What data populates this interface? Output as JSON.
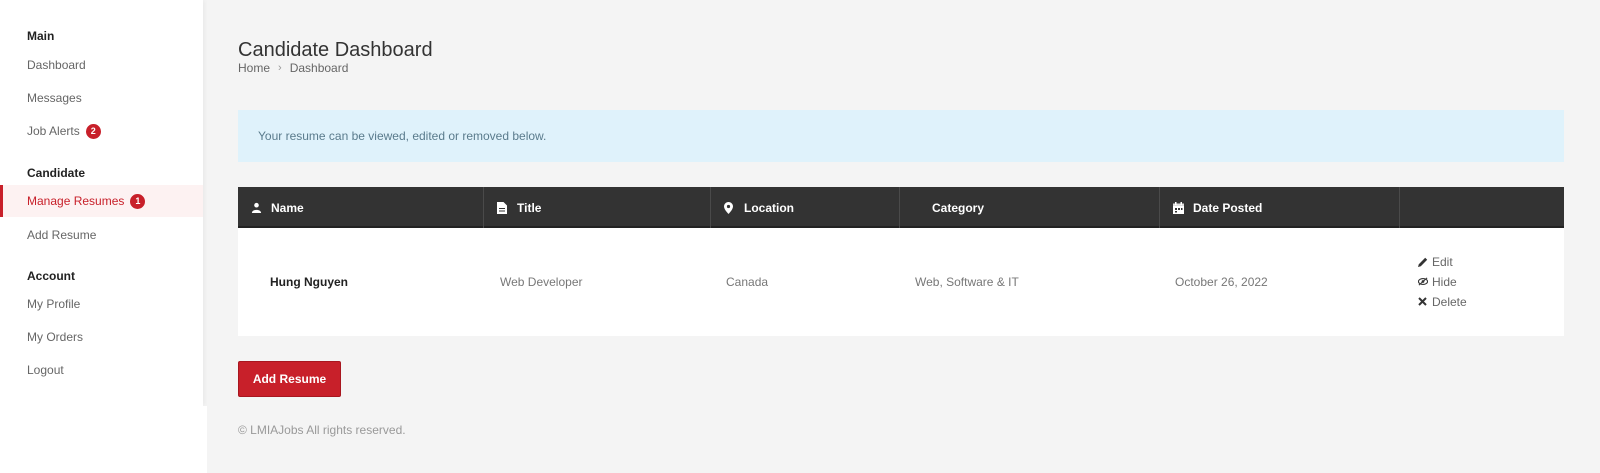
{
  "sidebar": {
    "groups": [
      "Main",
      "Candidate",
      "Account"
    ],
    "items": [
      {
        "label": "Dashboard"
      },
      {
        "label": "Messages"
      },
      {
        "label": "Job Alerts",
        "badge": "2"
      },
      {
        "label": "Manage Resumes",
        "badge": "1"
      },
      {
        "label": "Add Resume"
      },
      {
        "label": "My Profile"
      },
      {
        "label": "My Orders"
      },
      {
        "label": "Logout"
      }
    ]
  },
  "page": {
    "title": "Candidate Dashboard",
    "breadcrumb": [
      "Home",
      "Dashboard"
    ]
  },
  "notice": "Your resume can be viewed, edited or removed below.",
  "table": {
    "headers": [
      {
        "label": "Name",
        "icon": "user-icon"
      },
      {
        "label": "Title",
        "icon": "file-icon"
      },
      {
        "label": "Location",
        "icon": "map-pin-icon"
      },
      {
        "label": "Category",
        "icon": ""
      },
      {
        "label": "Date Posted",
        "icon": "calendar-icon"
      },
      {
        "label": "",
        "icon": ""
      }
    ],
    "rows": [
      {
        "name": "Hung Nguyen",
        "title": "Web Developer",
        "location": "Canada",
        "category": "Web, Software & IT",
        "date": "October 26, 2022",
        "actions": [
          "Edit",
          "Hide",
          "Delete"
        ]
      }
    ]
  },
  "add_button": "Add Resume",
  "footer": "© LMIAJobs All rights reserved.",
  "colors": {
    "accent": "#c8202a",
    "header_bg": "#333333",
    "notice_bg": "#dff2fb"
  }
}
